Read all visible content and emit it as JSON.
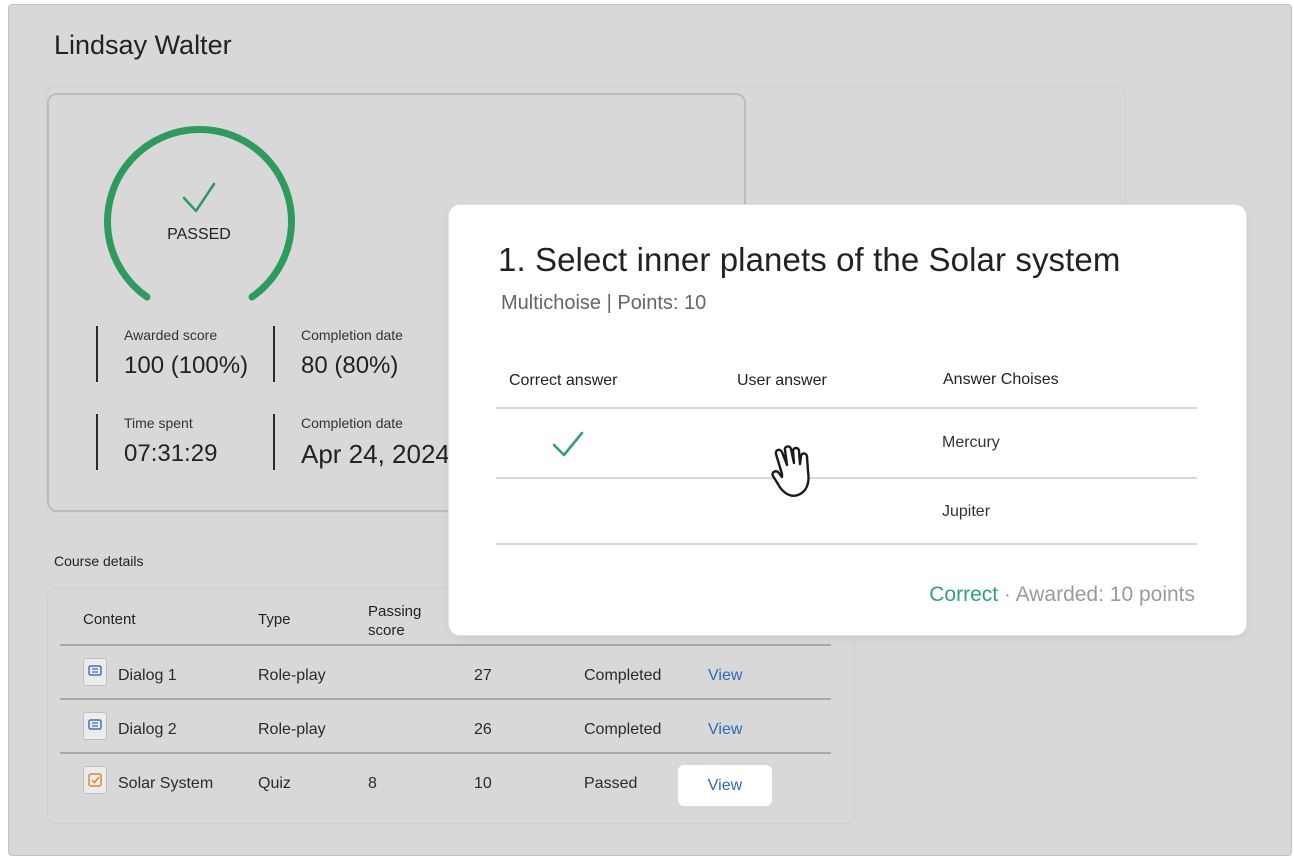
{
  "page": {
    "title": "Lindsay Walter"
  },
  "score": {
    "status": "PASSED",
    "stats": [
      {
        "label": "Awarded score",
        "value": "100 (100%)"
      },
      {
        "label": "Completion date",
        "value": "80 (80%)"
      },
      {
        "label": "Time spent",
        "value": "07:31:29"
      },
      {
        "label": "Completion date",
        "value": "Apr 24, 2024"
      }
    ]
  },
  "course": {
    "section_label": "Course details",
    "headers": [
      "Content",
      "Type",
      "Passing score"
    ],
    "rows": [
      {
        "icon": "dialog-icon",
        "content": "Dialog 1",
        "type": "Role-play",
        "passing": "",
        "score": "27",
        "status": "Completed",
        "action": "View"
      },
      {
        "icon": "dialog-icon",
        "content": "Dialog 2",
        "type": "Role-play",
        "passing": "",
        "score": "26",
        "status": "Completed",
        "action": "View"
      },
      {
        "icon": "quiz-icon",
        "content": "Solar System",
        "type": "Quiz",
        "passing": "8",
        "score": "10",
        "status": "Passed",
        "action": "View"
      }
    ]
  },
  "question": {
    "title": "1. Select inner planets of the Solar system",
    "subtitle": "Multichoise | Points: 10",
    "headers": [
      "Correct answer",
      "User answer",
      "Answer Choises"
    ],
    "rows": [
      {
        "correct": true,
        "choice": "Mercury"
      },
      {
        "correct": false,
        "choice": "Jupiter"
      }
    ],
    "result_status": "Correct",
    "result_detail": " · Awarded: 10 points"
  },
  "colors": {
    "success": "#31a36b",
    "gauge": "#2f9a5e",
    "link": "#2a6bb5"
  }
}
